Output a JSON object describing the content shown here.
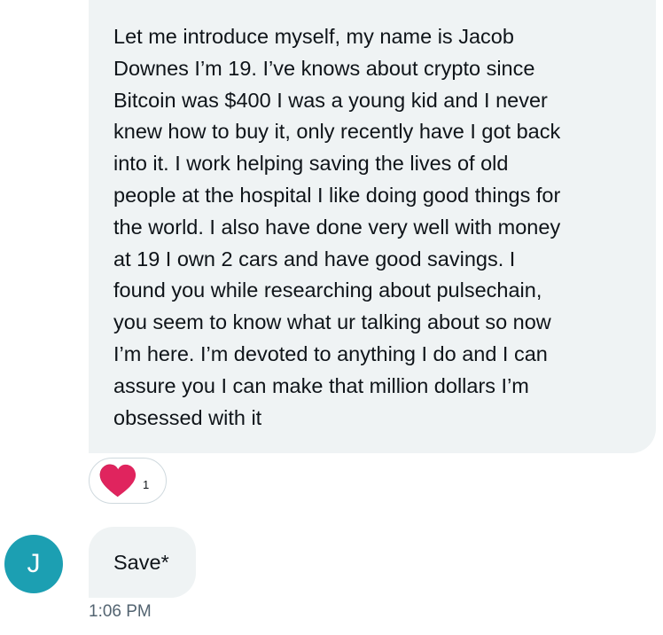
{
  "messages": [
    {
      "text": "Let me introduce myself, my name is Jacob\nDownes I’m 19. I’ve knows about crypto since\nBitcoin was $400 I was a young kid and I never\nknew how to buy it, only recently have I got back\ninto it. I work helping saving the lives of old\npeople at the hospital I like doing good things for\nthe world. I also have done very well with money\nat 19 I own 2 cars  and have good savings. I\nfound you while researching about pulsechain,\nyou seem to know what ur talking about so now\nI’m here. I’m devoted to anything I do and I can\nassure you I can make that million dollars I’m\nobsessed with it",
      "reaction": {
        "icon": "heart-icon",
        "count": "1",
        "color": "#e0245e"
      }
    },
    {
      "text": "Save*",
      "timestamp": "1:06 PM"
    }
  ],
  "sender": {
    "avatar_initial": "J",
    "avatar_color": "#1c9fb2"
  },
  "colors": {
    "bubble_bg": "#eff3f4",
    "text": "#0f1419",
    "muted": "#536471"
  }
}
